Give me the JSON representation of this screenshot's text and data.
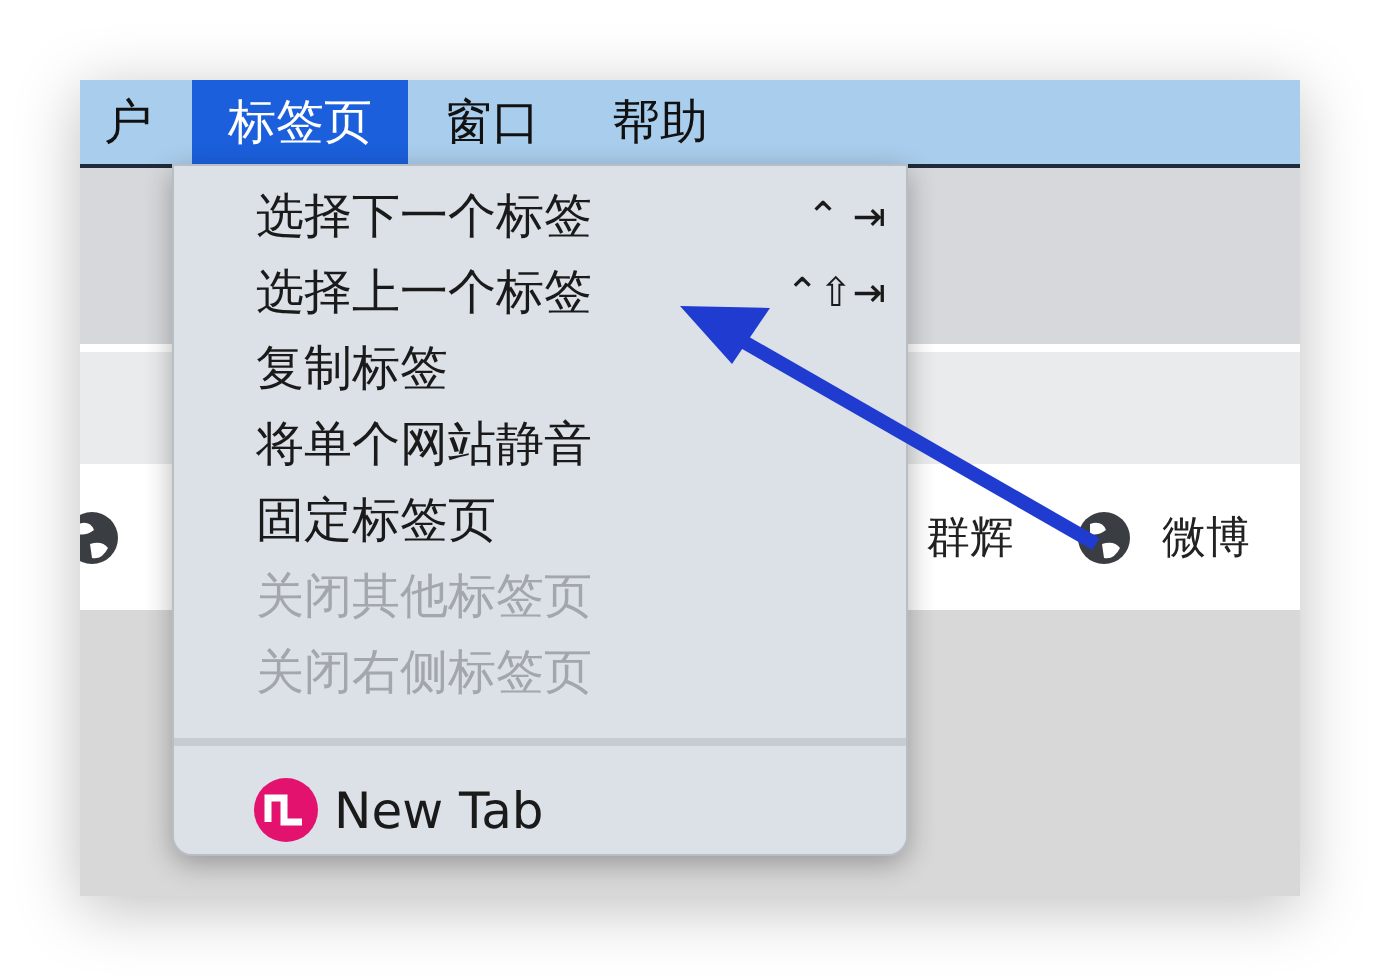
{
  "menubar": {
    "items": [
      {
        "label": "户",
        "selected": false
      },
      {
        "label": "标签页",
        "selected": true
      },
      {
        "label": "窗口",
        "selected": false
      },
      {
        "label": "帮助",
        "selected": false
      }
    ]
  },
  "bookmarks": [
    {
      "icon": true
    },
    {
      "label": "群辉",
      "icon": false
    },
    {
      "label": "微博",
      "icon": true
    }
  ],
  "menu": {
    "items": [
      {
        "kind": "item",
        "label": "选择下一个标签",
        "shortcut": "⌃ ⇥",
        "disabled": false
      },
      {
        "kind": "item",
        "label": "选择上一个标签",
        "shortcut": "⌃⇧⇥",
        "disabled": false
      },
      {
        "kind": "item",
        "label": "复制标签",
        "disabled": false
      },
      {
        "kind": "item",
        "label": "将单个网站静音",
        "disabled": false
      },
      {
        "kind": "item",
        "label": "固定标签页",
        "disabled": false
      },
      {
        "kind": "item",
        "label": "关闭其他标签页",
        "disabled": true
      },
      {
        "kind": "item",
        "label": "关闭右侧标签页",
        "disabled": true
      },
      {
        "kind": "separator"
      },
      {
        "kind": "tab",
        "label": "New Tab",
        "disabled": false
      }
    ]
  },
  "annotation": {
    "kind": "arrow"
  }
}
